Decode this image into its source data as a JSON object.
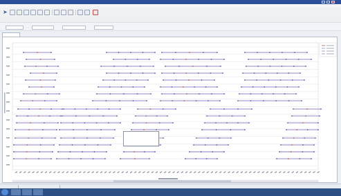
{
  "window": {
    "title": "",
    "titlebar_color": "#2d4f9a"
  },
  "menu": {
    "items": []
  },
  "toolbar": {
    "icons": [
      {
        "name": "back-icon",
        "color": "#3b5c9e"
      },
      {
        "name": "forward-icon",
        "color": "#3b5c9e"
      },
      {
        "name": "open-icon",
        "color": "#4f8fd8"
      },
      {
        "name": "save-icon",
        "color": "#62a15a"
      },
      {
        "name": "refresh-icon",
        "color": "#58a2dc"
      },
      {
        "name": "filter-icon",
        "color": "#8aa2c6"
      },
      {
        "name": "table-icon",
        "color": "#6f89b8"
      },
      {
        "name": "zoom-in-icon",
        "color": "#8c8c8c"
      },
      {
        "name": "zoom-out-icon",
        "color": "#8c8c8c"
      },
      {
        "name": "chart-icon",
        "color": "#5e7fb8"
      },
      {
        "name": "settings-icon",
        "color": "#7f7f7f"
      },
      {
        "name": "help-icon",
        "color": "#d23f3f"
      }
    ]
  },
  "row2": {
    "label": ""
  },
  "filters": {
    "fields": [
      {
        "label": "",
        "value": ""
      },
      {
        "label": "",
        "value": ""
      },
      {
        "label": "",
        "value": ""
      },
      {
        "label": "",
        "value": ""
      }
    ]
  },
  "panel": {
    "tab_label": ""
  },
  "chart_data": {
    "type": "scatter",
    "title": "",
    "xlabel": "",
    "ylabel": "",
    "legend": {
      "position": "top-right",
      "entries": []
    },
    "colors": {
      "line": "#9a86cb",
      "marker": "#5a4da3",
      "accent": "#b15a3c",
      "grid": "#d8dbe2"
    }
  },
  "popup": {
    "lines": []
  },
  "status": {
    "segments": []
  },
  "taskbar": {
    "clock": ""
  }
}
